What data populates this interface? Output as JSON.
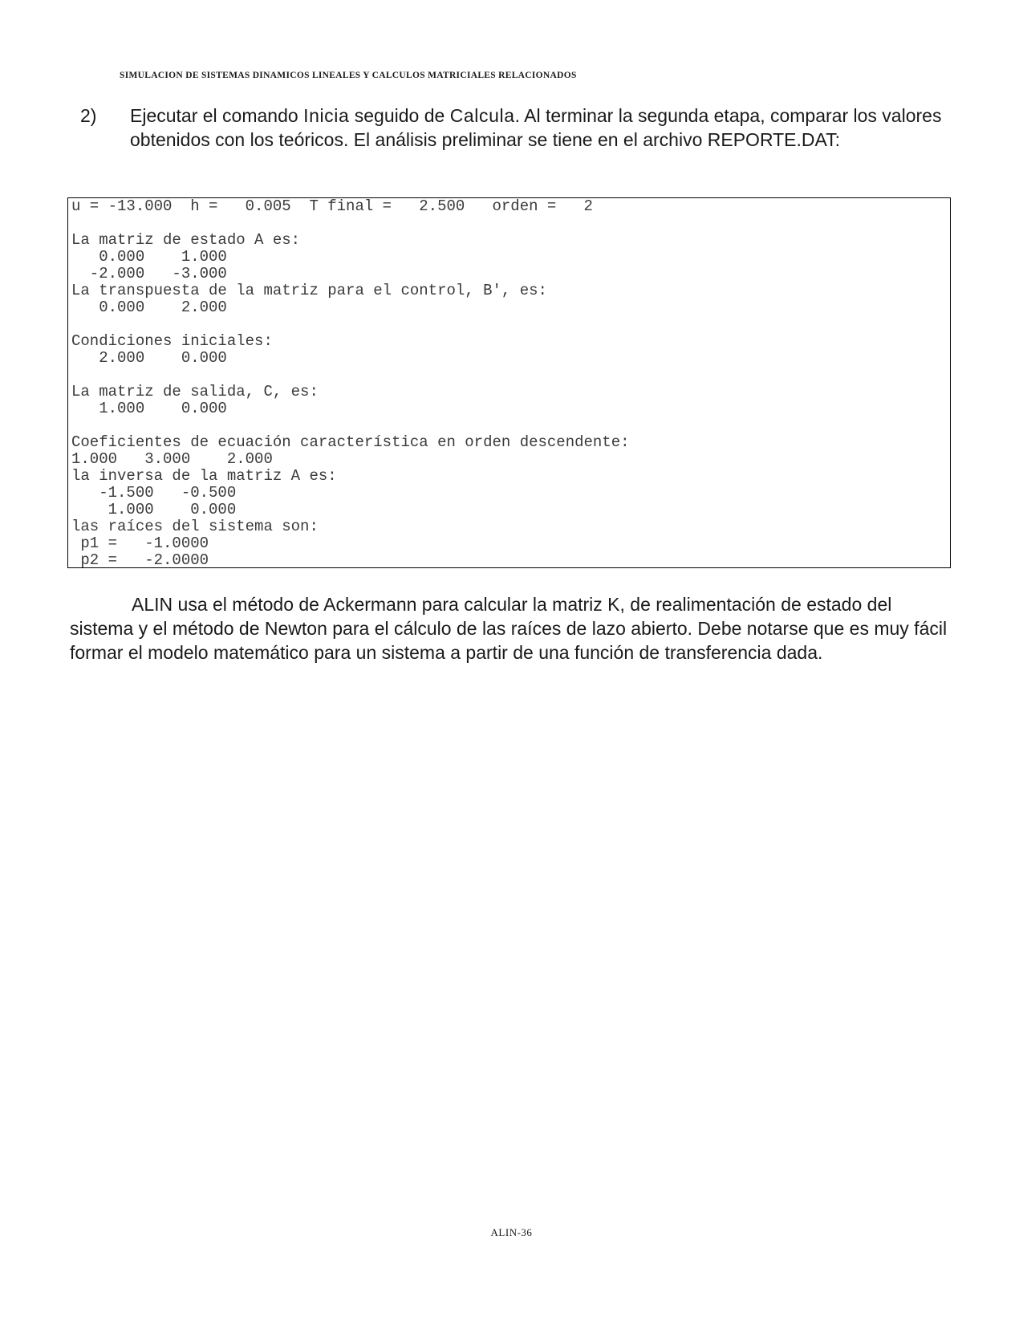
{
  "header": {
    "running_title": "SIMULACION DE SISTEMAS DINAMICOS LINEALES Y CALCULOS MATRICIALES RELACIONADOS"
  },
  "step": {
    "number": "2)",
    "text_before_cmd1": "Ejecutar el comando ",
    "cmd1": "Inicia",
    "text_between": " seguido de ",
    "cmd2": "Calcula",
    "text_after": ". Al terminar la segunda etapa, comparar los valores obtenidos con los teóricos. El análisis preliminar se tiene en el archivo REPORTE.DAT:"
  },
  "report": {
    "lines": [
      "u = -13.000  h =   0.005  T final =   2.500   orden =   2",
      "",
      "La matriz de estado A es:",
      "   0.000    1.000",
      "  -2.000   -3.000",
      "La transpuesta de la matriz para el control, B', es:",
      "   0.000    2.000",
      "",
      "Condiciones iniciales:",
      "   2.000    0.000",
      "",
      "La matriz de salida, C, es:",
      "   1.000    0.000",
      "",
      "Coeficientes de ecuación característica en orden descendente:",
      "1.000   3.000    2.000",
      "la inversa de la matriz A es:",
      "   -1.500   -0.500",
      "    1.000    0.000",
      "las raíces del sistema son:",
      " p1 =   -1.0000",
      " p2 =   -2.0000"
    ]
  },
  "paragraph": {
    "text": "ALIN usa el método de Ackermann para calcular la matriz K, de realimentación de estado del sistema y el método de Newton para el cálculo de las raíces de lazo abierto. Debe notarse que es muy fácil formar el modelo matemático para un sistema a partir de una función de transferencia dada."
  },
  "footer": {
    "page_label": "ALIN-36"
  }
}
